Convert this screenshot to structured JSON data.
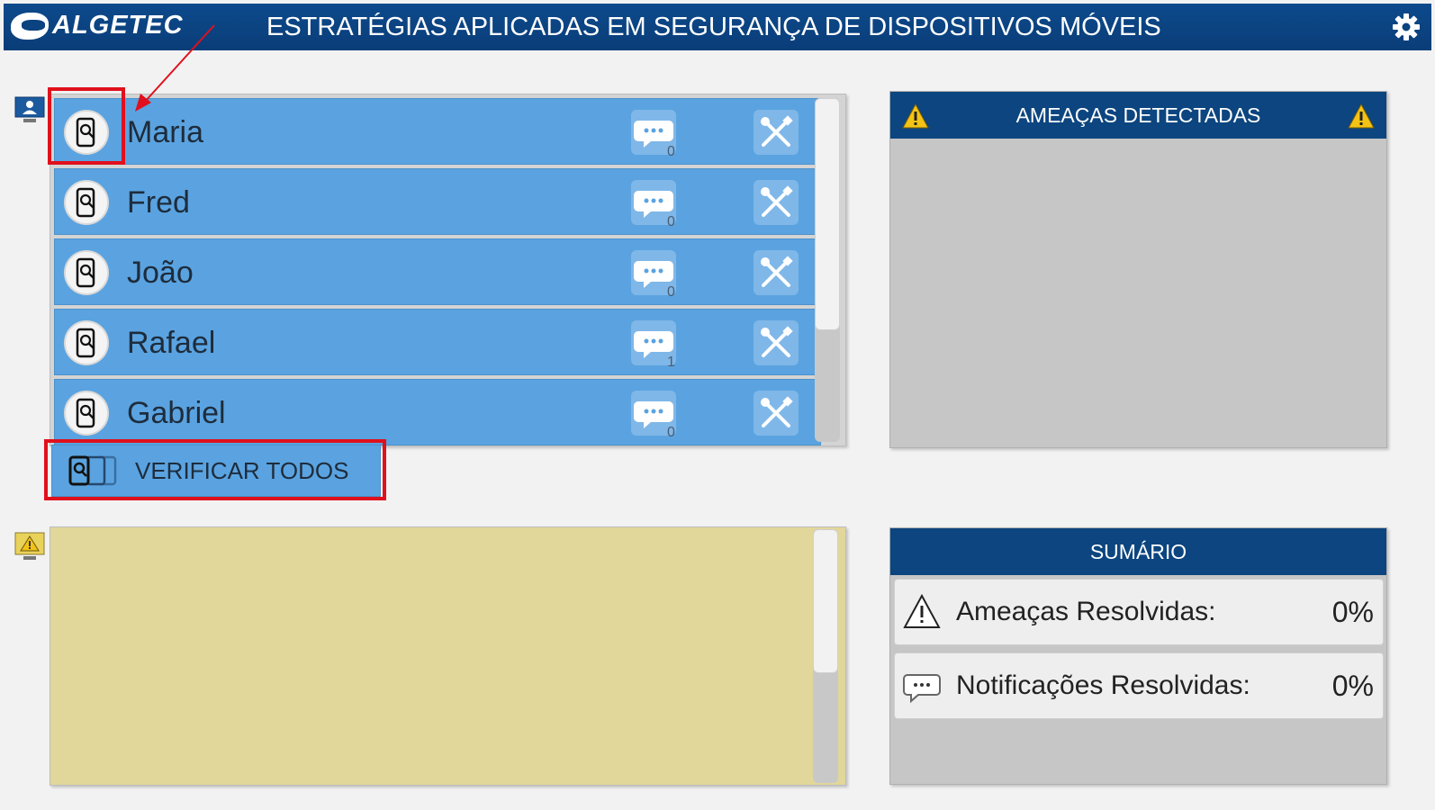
{
  "app": {
    "logo": "ALGETEC",
    "title": "ESTRATÉGIAS APLICADAS EM SEGURANÇA DE DISPOSITIVOS MÓVEIS"
  },
  "devices": [
    {
      "name": "Maria",
      "notifications": "0"
    },
    {
      "name": "Fred",
      "notifications": "0"
    },
    {
      "name": "João",
      "notifications": "0"
    },
    {
      "name": "Rafael",
      "notifications": "1"
    },
    {
      "name": "Gabriel",
      "notifications": "0"
    }
  ],
  "verify_all": {
    "label": "VERIFICAR TODOS"
  },
  "threats": {
    "title": "AMEAÇAS DETECTADAS"
  },
  "summary": {
    "title": "SUMÁRIO",
    "threats_label": "Ameaças Resolvidas:",
    "threats_value": "0%",
    "notifications_label": "Notificações Resolvidas:",
    "notifications_value": "0%"
  },
  "colors": {
    "header": "#0b4280",
    "row": "#5aa3e0",
    "notes": "#e2d79a",
    "highlight": "#e0101c"
  }
}
